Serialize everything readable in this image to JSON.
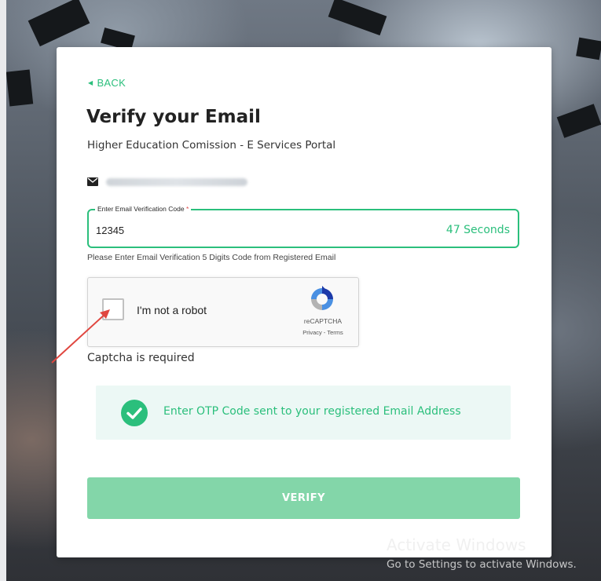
{
  "back_label": "BACK",
  "title": "Verify your Email",
  "subtitle": "Higher Education Comission - E Services Portal",
  "email_icon": "mail-icon",
  "code_field": {
    "label": "Enter Email Verification Code",
    "required_mark": "*",
    "value": "12345",
    "timer": "47 Seconds"
  },
  "hint": "Please Enter Email Verification 5 Digits Code from Registered Email",
  "recaptcha": {
    "label": "I'm not a robot",
    "brand": "reCAPTCHA",
    "links": "Privacy - Terms"
  },
  "captcha_error": "Captcha is required",
  "info_message": "Enter OTP Code sent to your registered Email Address",
  "verify_label": "VERIFY",
  "watermark": {
    "line1": "Activate Windows",
    "line2": "Go to Settings to activate Windows."
  },
  "colors": {
    "accent": "#2bbf7c",
    "button": "#83d6a9",
    "info_bg": "#ecf8f5",
    "annotation_arrow": "#e0463f"
  }
}
